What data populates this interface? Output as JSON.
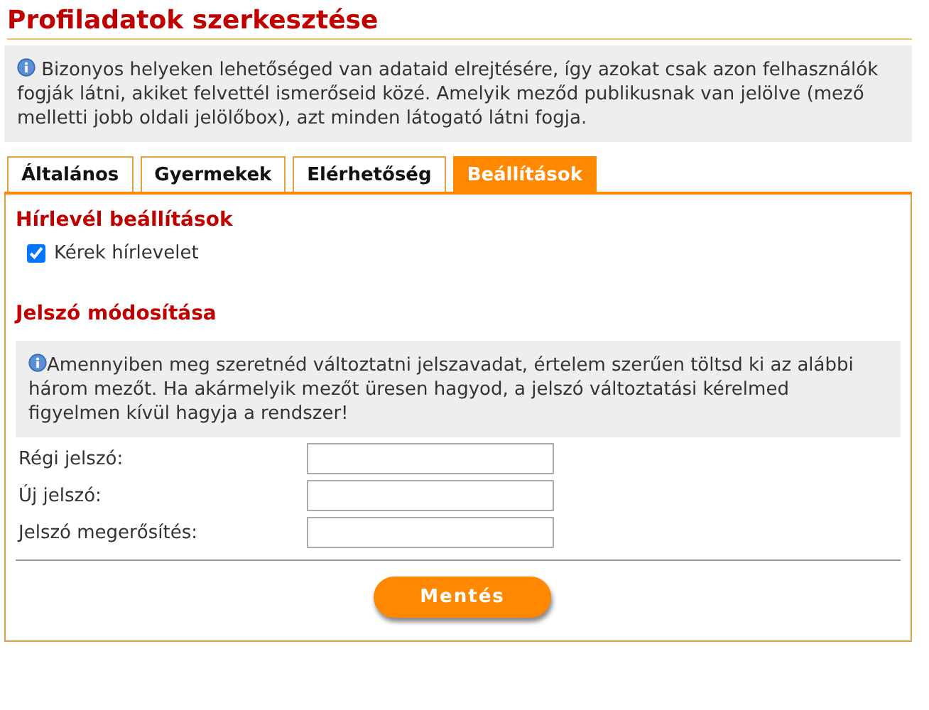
{
  "title": "Profiladatok szerkesztése",
  "info": "Bizonyos helyeken lehetőséged van adataid elrejtésére, így azokat csak azon felhasználók fogják látni, akiket felvettél ismerőseid közé. Amelyik meződ publikusnak van jelölve (mező melletti jobb oldali jelölőbox), azt minden látogató látni fogja.",
  "tabs": [
    {
      "label": "Általános",
      "selected": false
    },
    {
      "label": "Gyermekek",
      "selected": false
    },
    {
      "label": "Elérhetőség",
      "selected": false
    },
    {
      "label": "Beállítások",
      "selected": true
    }
  ],
  "newsletter": {
    "heading": "Hírlevél beállítások",
    "checkbox": {
      "label": "Kérek hírlevelet",
      "checked": true
    }
  },
  "password": {
    "heading": "Jelszó módosítása",
    "info": "Amennyiben meg szeretnéd változtatni jelszavadat, értelem szerűen töltsd ki az alábbi három mezőt. Ha akármelyik mezőt üresen hagyod, a jelszó változtatási kérelmed figyelmen kívül hagyja a rendszer!",
    "fields": [
      {
        "label": "Régi jelszó:"
      },
      {
        "label": "Új jelszó:"
      },
      {
        "label": "Jelszó megerősítés:"
      }
    ]
  },
  "save_button": "Mentés"
}
